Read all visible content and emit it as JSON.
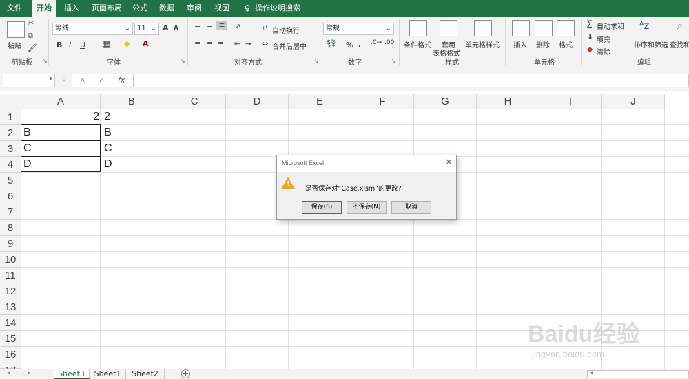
{
  "tabs": [
    "文件",
    "开始",
    "插入",
    "页面布局",
    "公式",
    "数据",
    "审阅",
    "视图",
    "操作说明搜索"
  ],
  "ribbon": {
    "clipboard": {
      "label": "剪贴板",
      "paste": "粘贴"
    },
    "font": {
      "label": "字体",
      "name": "等线",
      "size": "11",
      "bold": "B",
      "italic": "I",
      "underline": "U",
      "grow": "A",
      "shrink": "A"
    },
    "alignment": {
      "label": "对齐方式",
      "wrap": "自动换行",
      "merge": "合并后居中"
    },
    "number": {
      "label": "数字",
      "format": "常规",
      "percent": "%",
      "comma": ","
    },
    "styles": {
      "label": "样式",
      "conditional": "条件格式",
      "table_line1": "套用",
      "table_line2": "表格格式",
      "cell_styles": "单元格样式"
    },
    "cells": {
      "label": "单元格",
      "insert": "插入",
      "delete": "删除",
      "format": "格式"
    },
    "editing": {
      "label": "编辑",
      "autosum": "自动求和",
      "fill": "填充",
      "clear": "清除",
      "sort": "排序和筛选",
      "find": "查找和"
    }
  },
  "formula_bar": {
    "fx": "fx",
    "cancel": "✕",
    "enter": "✓"
  },
  "columns": [
    "A",
    "B",
    "C",
    "D",
    "E",
    "F",
    "G",
    "H",
    "I",
    "J"
  ],
  "rows": [
    "1",
    "2",
    "3",
    "4",
    "5",
    "6",
    "7",
    "8",
    "9",
    "10",
    "11",
    "12",
    "13",
    "14",
    "15",
    "16",
    "17"
  ],
  "cells": {
    "A1": "2",
    "A2": "B",
    "A3": "C",
    "A4": "D",
    "B1": "2",
    "B2": "B",
    "B3": "C",
    "B4": "D"
  },
  "dialog": {
    "title": "Microsoft Excel",
    "close": "✕",
    "message": "是否保存对“Case.xlsm”的更改?",
    "save": "保存(S)",
    "dont_save": "不保存(N)",
    "cancel": "取消"
  },
  "sheets": [
    "Sheet3",
    "Sheet1",
    "Sheet2"
  ],
  "add_sheet": "+",
  "watermark": {
    "brand": "Baidu经验",
    "url": "jingyan.baidu.com"
  },
  "colors": {
    "accent": "#217346",
    "warning": "#e8a72c"
  }
}
